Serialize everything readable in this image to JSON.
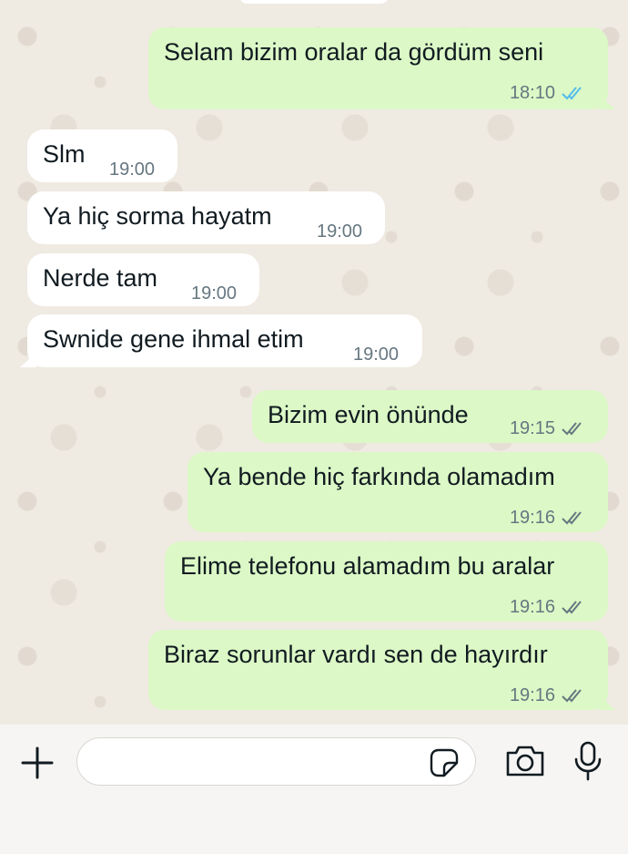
{
  "conversation": {
    "messages": [
      {
        "direction": "outgoing",
        "text": "Selam bizim oralar da gördüm seni",
        "time": "18:10",
        "status": "read",
        "status_icon": "double-check-icon",
        "status_color": "#53bdeb"
      },
      {
        "direction": "incoming",
        "text": "Slm",
        "time": "19:00"
      },
      {
        "direction": "incoming",
        "text": "Ya hiç sorma hayatm",
        "time": "19:00"
      },
      {
        "direction": "incoming",
        "text": "Nerde tam",
        "time": "19:00"
      },
      {
        "direction": "incoming",
        "text": "Swnide gene ihmal etim",
        "time": "19:00"
      },
      {
        "direction": "outgoing",
        "text": "Bizim evin önünde",
        "time": "19:15",
        "status": "delivered",
        "status_icon": "double-check-icon",
        "status_color": "#667781"
      },
      {
        "direction": "outgoing",
        "text": "Ya bende hiç farkında olamadım",
        "time": "19:16",
        "status": "delivered",
        "status_icon": "double-check-icon",
        "status_color": "#667781"
      },
      {
        "direction": "outgoing",
        "text": "Elime telefonu alamadım bu aralar",
        "time": "19:16",
        "status": "delivered",
        "status_icon": "double-check-icon",
        "status_color": "#667781"
      },
      {
        "direction": "outgoing",
        "text": "Biraz sorunlar vardı sen de hayırdır",
        "time": "19:16",
        "status": "delivered",
        "status_icon": "double-check-icon",
        "status_color": "#667781"
      }
    ]
  },
  "input_bar": {
    "attach_icon": "plus-icon",
    "message_value": "",
    "sticker_icon": "sticker-icon",
    "camera_icon": "camera-icon",
    "mic_icon": "microphone-icon"
  },
  "colors": {
    "chat_background": "#efeae2",
    "incoming_bubble": "#ffffff",
    "outgoing_bubble": "#dcf8c6",
    "read_tick": "#53bdeb",
    "meta_text": "#667781"
  }
}
